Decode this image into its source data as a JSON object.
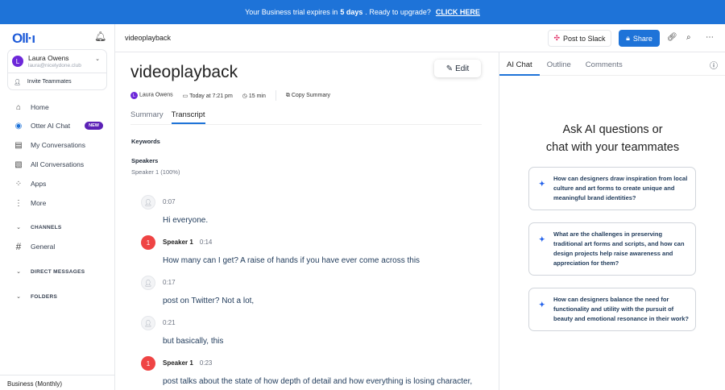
{
  "banner": {
    "pre": "Your Business trial expires in",
    "days": "5 days",
    "mid": ". Ready to upgrade?",
    "cta": "CLICK HERE"
  },
  "sidebar": {
    "logo": "Oll·ı",
    "user": {
      "initial": "L",
      "name": "Laura Owens",
      "email": "laura@nicelydone.club"
    },
    "invite": "Invite Teammates",
    "items": [
      {
        "label": "Home",
        "icon": "⌂"
      },
      {
        "label": "Otter AI Chat",
        "icon": "◉",
        "badge": "NEW"
      },
      {
        "label": "My Conversations",
        "icon": "▤"
      },
      {
        "label": "All Conversations",
        "icon": "▧"
      },
      {
        "label": "Apps",
        "icon": "⁘"
      },
      {
        "label": "More",
        "icon": "⋮"
      }
    ],
    "channels": "CHANNELS",
    "general": "General",
    "dms": "DIRECT MESSAGES",
    "folders": "FOLDERS",
    "plan": "Business (Monthly)"
  },
  "topbar": {
    "title": "videoplayback",
    "slack": "Post to Slack",
    "share": "Share"
  },
  "doc": {
    "title": "videoplayback",
    "edit": "Edit",
    "owner": "Laura Owens",
    "owner_initial": "L",
    "date": "Today at 7:21 pm",
    "duration": "15 min",
    "copy": "Copy Summary",
    "tabs": [
      "Summary",
      "Transcript"
    ],
    "keywords": "Keywords",
    "speakers": "Speakers",
    "speaker_value": "Speaker 1 (100%)",
    "segments": [
      {
        "speaker": "",
        "avatar": "",
        "time": "0:07",
        "text": "Hi everyone."
      },
      {
        "speaker": "Speaker 1",
        "avatar": "1",
        "time": "0:14",
        "text": "How many can I get? A raise of hands if you have ever come across this"
      },
      {
        "speaker": "",
        "avatar": "",
        "time": "0:17",
        "text": "post on Twitter? Not a lot,"
      },
      {
        "speaker": "",
        "avatar": "",
        "time": "0:21",
        "text": "but basically, this"
      },
      {
        "speaker": "Speaker 1",
        "avatar": "1",
        "time": "0:23",
        "text": "post talks about the state of how depth of detail and how everything is losing character, and basically everything is starting to look the same. Right? Have you"
      }
    ]
  },
  "panel": {
    "tabs": [
      "AI Chat",
      "Outline",
      "Comments"
    ],
    "heading1": "Ask AI questions or",
    "heading2": "chat with your teammates",
    "questions": [
      "How can designers draw inspiration from local culture and art forms to create unique and meaningful brand identities?",
      "What are the challenges in preserving traditional art forms and scripts, and how can design projects help raise awareness and appreciation for them?",
      "How can designers balance the need for functionality and utility with the pursuit of beauty and emotional resonance in their work?"
    ]
  }
}
